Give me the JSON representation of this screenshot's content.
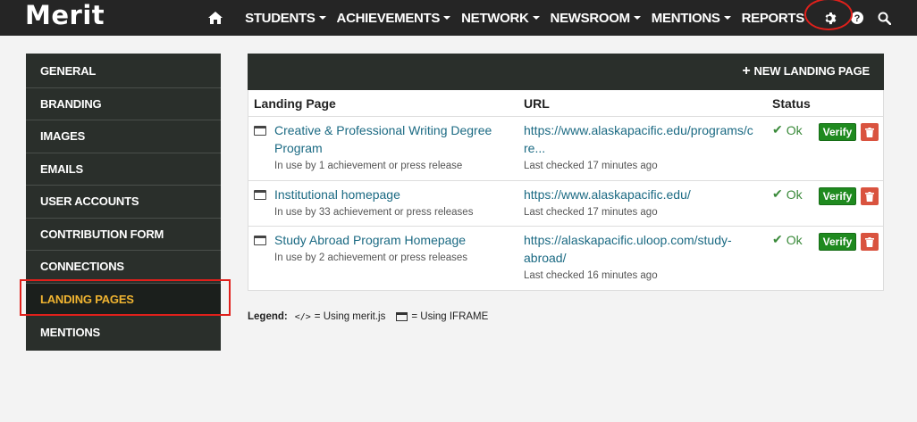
{
  "header": {
    "logo": "Merit",
    "nav": [
      {
        "label": "STUDENTS"
      },
      {
        "label": "ACHIEVEMENTS"
      },
      {
        "label": "NETWORK"
      },
      {
        "label": "NEWSROOM"
      },
      {
        "label": "MENTIONS"
      },
      {
        "label": "REPORTS"
      }
    ],
    "icons": [
      "home-icon",
      "gear-icon",
      "help-icon",
      "search-icon"
    ]
  },
  "sidebar": {
    "items": [
      {
        "label": "GENERAL"
      },
      {
        "label": "BRANDING"
      },
      {
        "label": "IMAGES"
      },
      {
        "label": "EMAILS"
      },
      {
        "label": "USER ACCOUNTS"
      },
      {
        "label": "CONTRIBUTION FORM"
      },
      {
        "label": "CONNECTIONS"
      },
      {
        "label": "LANDING PAGES"
      },
      {
        "label": "MENTIONS"
      }
    ],
    "active": "LANDING PAGES"
  },
  "panel": {
    "new_button": "NEW LANDING PAGE",
    "columns": {
      "page": "Landing Page",
      "url": "URL",
      "status": "Status"
    },
    "rows": [
      {
        "name": "Creative & Professional Writing Degree Program",
        "usage": "In use by 1 achievement or press release",
        "url": "https://www.alaskapacific.edu/programs/cre...",
        "checked": "Last checked 17 minutes ago",
        "status": "Ok",
        "verify": "Verify"
      },
      {
        "name": "Institutional homepage",
        "usage": "In use by 33 achievement or press releases",
        "url": "https://www.alaskapacific.edu/",
        "checked": "Last checked 17 minutes ago",
        "status": "Ok",
        "verify": "Verify"
      },
      {
        "name": "Study Abroad Program Homepage",
        "usage": "In use by 2 achievement or press releases",
        "url": "https://alaskapacific.uloop.com/study-abroad/",
        "checked": "Last checked 16 minutes ago",
        "status": "Ok",
        "verify": "Verify"
      }
    ]
  },
  "legend": {
    "label": "Legend:",
    "code_symbol": "</>",
    "merit_js": "= Using merit.js",
    "iframe": "= Using IFRAME"
  },
  "colors": {
    "topbar": "#252525",
    "sidebar": "#2a2f2b",
    "active": "#f0b431",
    "link": "#1b6a83",
    "ok": "#3a8a3a",
    "verify": "#1f8a1f",
    "delete": "#d9533f",
    "highlight": "#e0201b"
  }
}
